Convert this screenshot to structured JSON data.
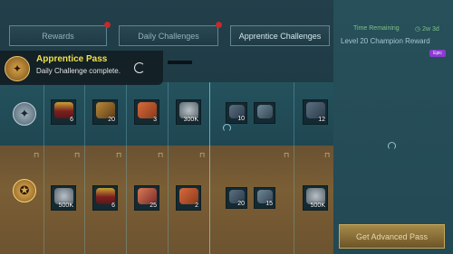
{
  "tabs": [
    {
      "label": "Rewards",
      "has_alert": true
    },
    {
      "label": "Daily Challenges",
      "has_alert": true
    },
    {
      "label": "Apprentice Challenges",
      "has_alert": false
    }
  ],
  "notification": {
    "title": "Apprentice Pass",
    "message": "Daily Challenge complete."
  },
  "free_track": [
    {
      "icon": "treasure-chest-icon",
      "qty": "6"
    },
    {
      "icon": "scroll-icon",
      "qty": "20"
    },
    {
      "icon": "meat-icon",
      "qty": "3"
    },
    {
      "icon": "silver-coin-icon",
      "qty": "300K"
    },
    {
      "icon": "flask-icon",
      "qty": "10"
    },
    {
      "icon": "key-icon",
      "qty": ""
    },
    {
      "icon": "potion-icon",
      "qty": "12"
    }
  ],
  "premium_track": [
    {
      "icon": "silver-coin-icon",
      "qty": "500K"
    },
    {
      "icon": "treasure-chest-icon",
      "qty": "6"
    },
    {
      "icon": "sack-icon",
      "qty": "25"
    },
    {
      "icon": "meat-icon",
      "qty": "2"
    },
    {
      "icon": "flask-icon",
      "qty": "20"
    },
    {
      "icon": "key-icon",
      "qty": "15"
    },
    {
      "icon": "silver-coin-icon",
      "qty": "500K"
    }
  ],
  "side_panel": {
    "time_label": "Time Remaining",
    "time_value": "2w 3d",
    "level_reward": "Level 20 Champion Reward",
    "rarity": "Epic",
    "advanced_button": "Get Advanced Pass"
  },
  "colors": {
    "accent_yellow": "#f0e24a",
    "alert_red": "#c42a2a",
    "epic_purple": "#8a3bd0"
  }
}
